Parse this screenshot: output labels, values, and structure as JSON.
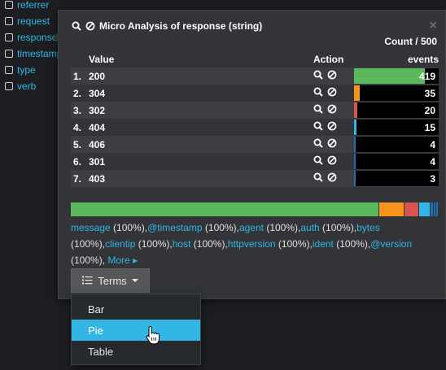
{
  "sidebar": {
    "fields": [
      "referrer",
      "request",
      "response",
      "timestamp",
      "type",
      "verb"
    ]
  },
  "popover": {
    "title": "Micro Analysis of response (string)",
    "close_glyph": "×",
    "count_label": "Count / 500",
    "columns": {
      "value": "Value",
      "action": "Action",
      "events": "events"
    },
    "rows": [
      {
        "index": "1.",
        "value": "200",
        "count": "419",
        "color": "#5cb85c"
      },
      {
        "index": "2.",
        "value": "304",
        "count": "35",
        "color": "#f7941d"
      },
      {
        "index": "3.",
        "value": "302",
        "count": "20",
        "color": "#d9534f"
      },
      {
        "index": "4.",
        "value": "404",
        "count": "15",
        "color": "#33b5e5"
      },
      {
        "index": "5.",
        "value": "406",
        "count": "4",
        "color": "#1f6fb2"
      },
      {
        "index": "6.",
        "value": "301",
        "count": "4",
        "color": "#1f6fb2"
      },
      {
        "index": "7.",
        "value": "403",
        "count": "3",
        "color": "#1f6fb2"
      }
    ],
    "stack_colors": [
      "#5cb85c",
      "#f7941d",
      "#d9534f",
      "#33b5e5",
      "#1f6fb2",
      "#1f6fb2",
      "#1f6fb2"
    ],
    "fields_presence": [
      {
        "name": "message",
        "pct": " (100%),"
      },
      {
        "name": "@timestamp",
        "pct": " (100%),"
      },
      {
        "name": "agent",
        "pct": " (100%),"
      },
      {
        "name": "auth",
        "pct": " (100%),"
      },
      {
        "name": "bytes",
        "pct": " (100%),"
      },
      {
        "name": "clientip",
        "pct": " (100%),"
      },
      {
        "name": "host",
        "pct": " (100%),"
      },
      {
        "name": "httpversion",
        "pct": " (100%),"
      },
      {
        "name": "ident",
        "pct": " (100%),"
      },
      {
        "name": "@version",
        "pct": " (100%),"
      }
    ],
    "more_label": "More",
    "terms_button": "Terms"
  },
  "dropdown": {
    "items": [
      "Bar",
      "Pie",
      "Table"
    ],
    "active": "Pie"
  },
  "icons": {
    "search": "search-icon",
    "ban": "ban-icon",
    "list": "list-icon",
    "hand": "hand-pointer-icon"
  }
}
